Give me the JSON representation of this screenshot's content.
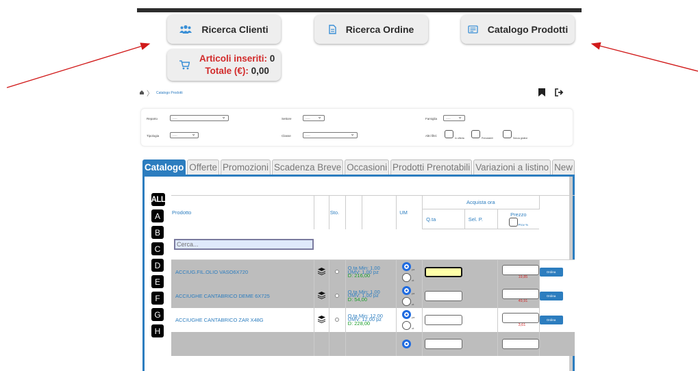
{
  "top_buttons": {
    "ricerca_clienti": "Ricerca Clienti",
    "ricerca_ordine": "Ricerca Ordine",
    "catalogo_prodotti": "Catalogo Prodotti"
  },
  "cart": {
    "articoli_label": "Articoli inseriti:",
    "articoli_value": "0",
    "totale_label": "Totale (€):",
    "totale_value": "0,00"
  },
  "breadcrumb": {
    "current": "Catalogo Prodotti"
  },
  "filters": {
    "reparto_label": "Reparto",
    "settore_label": "Settore",
    "famiglia_label": "Famiglia",
    "tipologia_label": "Tipologia",
    "classe_label": "Classe",
    "altri_label": "Altri filtri:",
    "placeholder": "-----",
    "chk1": "In offerta",
    "chk2": "Prenotabili",
    "chk3": "Senza glutine"
  },
  "tabs": [
    "Catalogo",
    "Offerte",
    "Promozioni",
    "Scadenza Breve",
    "Occasioni",
    "Prodotti Prenotabili",
    "Variazioni a listino",
    "New"
  ],
  "letters": [
    "ALL",
    "A",
    "B",
    "C",
    "D",
    "E",
    "F",
    "G",
    "H"
  ],
  "table": {
    "col_prodotto": "Prodotto",
    "col_sto": "Sto.",
    "col_um": "UM",
    "col_acquista": "Acquista ora",
    "col_qta": "Q.ta",
    "col_selp": "Sel. P.",
    "col_prezzo": "Prezzo",
    "col_prov": "Prov %",
    "search_placeholder": "Cerca..."
  },
  "products": [
    {
      "name": "ACCIUG.FIL.OLIO VASO6X720",
      "qmin": "Q.ta Min: 1,00",
      "umv": "UMV: 1,00 pz",
      "disp": "D: 216,00",
      "um1": "pz",
      "um2": "ct",
      "price": "19,85",
      "ordina": "Ordina"
    },
    {
      "name": "ACCIUGHE CANTABRICO DEME 6X725",
      "qmin": "Q.ta Min: 1,00",
      "umv": "UMV: 1,00 pz",
      "disp": "D: 54,00",
      "um1": "pz",
      "um2": "ct",
      "price": "49,91",
      "ordina": "Ordina"
    },
    {
      "name": "ACCIUGHE CANTABRICO ZAR  X48G",
      "qmin": "Q.ta Min: 12,00",
      "umv": "UMV: 12,00 pz",
      "disp": "D: 228,00",
      "um1": "pz",
      "um2": "ct",
      "price": "3,61",
      "ordina": "Ordina"
    }
  ],
  "colors": {
    "accent": "#2c7dbf",
    "red": "#d22a2a",
    "green": "#1a9e2a",
    "icon_blue": "#3a8fd6"
  }
}
